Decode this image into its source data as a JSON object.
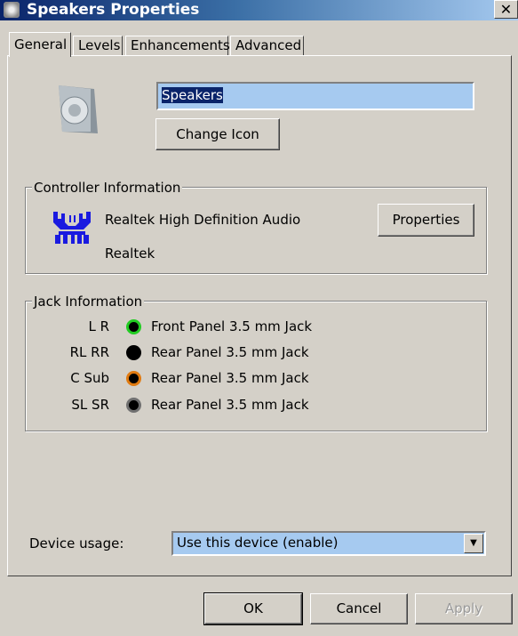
{
  "window": {
    "title": "Speakers Properties",
    "close": "✕"
  },
  "tabs": [
    {
      "label": "General",
      "selected": true
    },
    {
      "label": "Levels"
    },
    {
      "label": "Enhancements"
    },
    {
      "label": "Advanced"
    }
  ],
  "general": {
    "name_value": "Speakers",
    "change_icon_label": "Change Icon",
    "controller": {
      "legend": "Controller Information",
      "name": "Realtek High Definition Audio",
      "vendor": "Realtek",
      "properties_label": "Properties"
    },
    "jack": {
      "legend": "Jack Information",
      "rows": [
        {
          "channels": "L R",
          "color": "#22cc22",
          "location": "Front Panel 3.5 mm Jack"
        },
        {
          "channels": "RL RR",
          "color": "#000000",
          "location": "Rear Panel 3.5 mm Jack"
        },
        {
          "channels": "C Sub",
          "color": "#e07a10",
          "location": "Rear Panel 3.5 mm Jack"
        },
        {
          "channels": "SL SR",
          "color": "#707070",
          "location": "Rear Panel 3.5 mm Jack"
        }
      ]
    },
    "device_usage_label": "Device usage:",
    "device_usage_value": "Use this device (enable)"
  },
  "buttons": {
    "ok": "OK",
    "cancel": "Cancel",
    "apply": "Apply"
  }
}
